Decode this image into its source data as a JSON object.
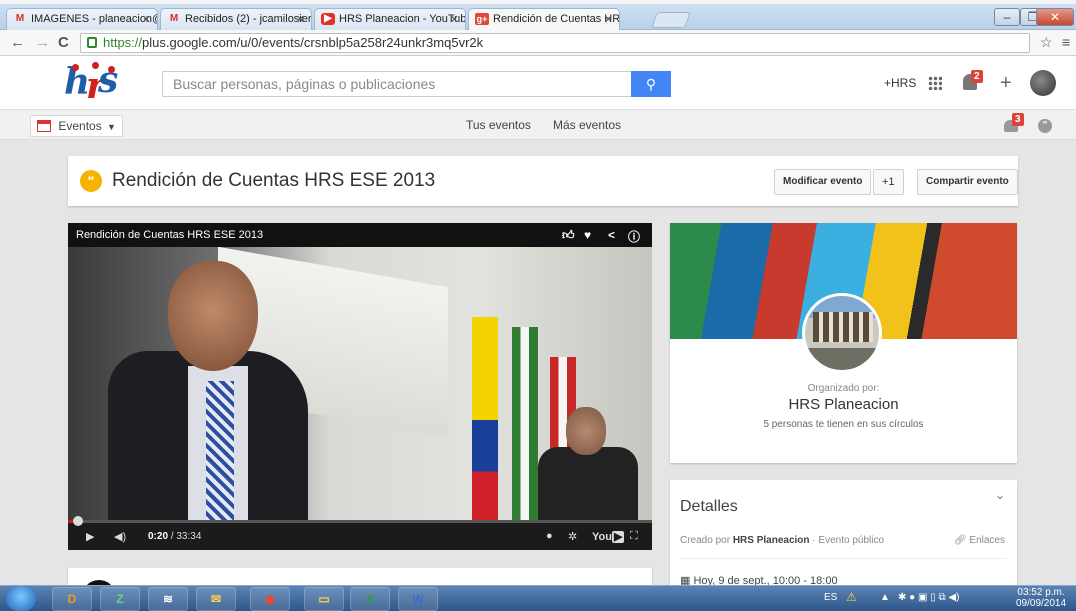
{
  "browser": {
    "tabs": [
      {
        "label": "IMAGENES - planeacion@",
        "icon": "gmail-icon",
        "active": false
      },
      {
        "label": "Recibidos (2) - jcamilosier",
        "icon": "gmail-icon",
        "active": false
      },
      {
        "label": "HRS Planeacion - YouTub",
        "icon": "youtube-icon",
        "active": false
      },
      {
        "label": "Rendición de Cuentas HR:",
        "icon": "google-plus-icon",
        "active": true
      }
    ],
    "url": "https://plus.google.com/u/0/events/crsnblp5a258r24unkr3mq5vr2k",
    "url_scheme": "https://",
    "url_rest": "plus.google.com/u/0/events/crsnblp5a258r24unkr3mq5vr2k"
  },
  "header": {
    "search_placeholder": "Buscar personas, páginas o publicaciones",
    "profile_link": "+HRS",
    "notification_count": "2"
  },
  "subnav": {
    "events_label": "Eventos",
    "link_your_events": "Tus eventos",
    "link_more_events": "Más eventos",
    "people_badge": "3"
  },
  "event": {
    "title": "Rendición de Cuentas HRS ESE 2013",
    "btn_edit": "Modificar evento",
    "btn_plusone": "+1",
    "btn_share": "Compartir evento"
  },
  "video": {
    "title": "Rendición de Cuentas HRS ESE 2013",
    "current_time": "0:20",
    "duration": "/ 33:34",
    "progress": 0.01,
    "youtube_label": "You"
  },
  "organizer": {
    "label": "Organizado por:",
    "name": "HRS Planeacion",
    "circles": "5 personas te tienen en sus círculos"
  },
  "details": {
    "title": "Detalles",
    "created_prefix": "Creado por",
    "created_by": "HRS Planeacion",
    "visibility": "· Evento público",
    "links": "Enlaces",
    "date": "Hoy, 9 de sept., 10:00 - 18:00"
  },
  "taskbar": {
    "lang": "ES",
    "time": "03:52 p.m.",
    "date": "09/09/2014"
  },
  "colors": {
    "search_button": "#4285f4",
    "badge": "#db4437",
    "event_icon": "#f6b400",
    "progress": "#cc181e"
  }
}
